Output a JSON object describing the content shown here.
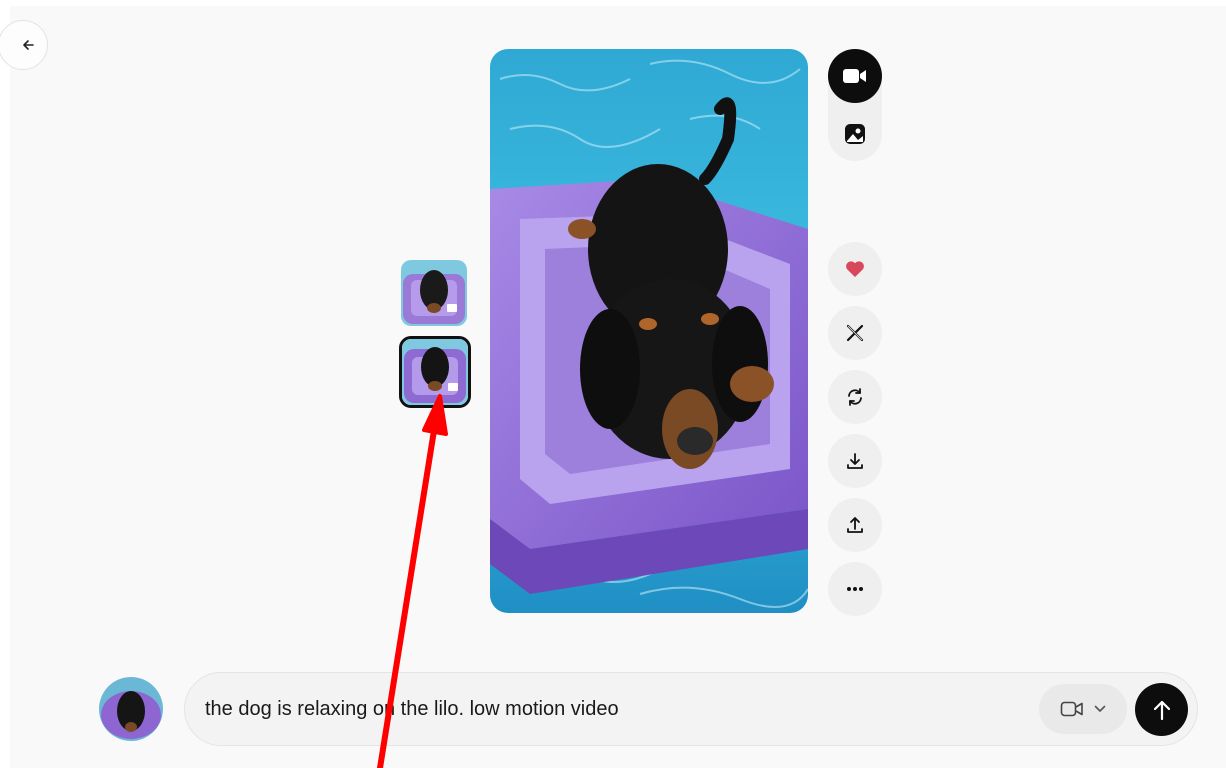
{
  "prompt": {
    "text": "the dog is relaxing on the lilo. low motion video"
  },
  "mode_switch": {
    "selected": "video",
    "options": [
      "video-icon",
      "image-icon"
    ]
  },
  "actions": [
    "heart-icon",
    "x-logo-icon",
    "refresh-icon",
    "download-icon",
    "share-icon",
    "more-icon"
  ],
  "thumbnails": {
    "count": 2,
    "selected_index": 1
  },
  "colors": {
    "accent": "#0d0d0d",
    "like": "#d9485a",
    "annotation": "#ff0000"
  }
}
